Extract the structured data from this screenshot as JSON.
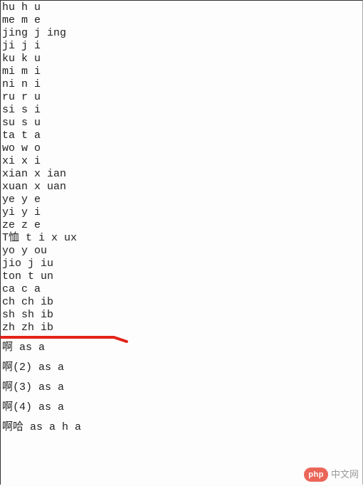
{
  "lines": [
    {
      "text": "hu h u",
      "spaced": false
    },
    {
      "text": "me m e",
      "spaced": false
    },
    {
      "text": "jing j ing",
      "spaced": false
    },
    {
      "text": "ji j i",
      "spaced": false
    },
    {
      "text": "ku k u",
      "spaced": false
    },
    {
      "text": "mi m i",
      "spaced": false
    },
    {
      "text": "ni n i",
      "spaced": false
    },
    {
      "text": "ru r u",
      "spaced": false
    },
    {
      "text": "si s i",
      "spaced": false
    },
    {
      "text": "su s u",
      "spaced": false
    },
    {
      "text": "ta t a",
      "spaced": false
    },
    {
      "text": "wo w o",
      "spaced": false
    },
    {
      "text": "xi x i",
      "spaced": false
    },
    {
      "text": "xian x ian",
      "spaced": false
    },
    {
      "text": "xuan x uan",
      "spaced": false
    },
    {
      "text": "ye y e",
      "spaced": false
    },
    {
      "text": "yi y i",
      "spaced": false
    },
    {
      "text": "ze z e",
      "spaced": false
    },
    {
      "text": "T恤 t i x ux",
      "spaced": false
    },
    {
      "text": "yo y ou",
      "spaced": false
    },
    {
      "text": "jio j iu",
      "spaced": false
    },
    {
      "text": "ton t un",
      "spaced": false
    },
    {
      "text": "ca c a",
      "spaced": false
    },
    {
      "text": "ch ch ib",
      "spaced": false
    },
    {
      "text": "sh sh ib",
      "spaced": false
    },
    {
      "text": "zh zh ib",
      "spaced": false
    },
    {
      "text": "啊 as a",
      "spaced": true
    },
    {
      "text": "啊(2) as a",
      "spaced": true
    },
    {
      "text": "啊(3) as a",
      "spaced": true
    },
    {
      "text": "啊(4) as a",
      "spaced": true
    },
    {
      "text": "啊哈 as a h a",
      "spaced": true
    }
  ],
  "watermark": {
    "badge": "php",
    "text": "中文网"
  }
}
